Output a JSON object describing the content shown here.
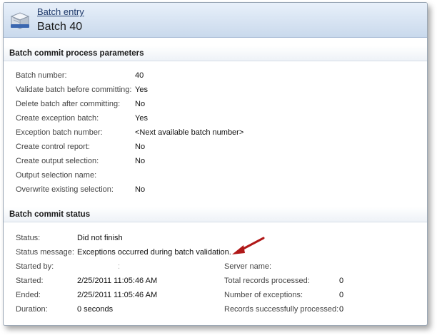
{
  "header": {
    "link": "Batch entry",
    "title": "Batch 40"
  },
  "params": {
    "section_title": "Batch commit process parameters",
    "rows": [
      {
        "label": "Batch number:",
        "value": "40"
      },
      {
        "label": "Validate batch before committing:",
        "value": "Yes"
      },
      {
        "label": "Delete batch after committing:",
        "value": "No"
      },
      {
        "label": "Create exception batch:",
        "value": "Yes"
      },
      {
        "label": "Exception batch number:",
        "value": "<Next available batch number>"
      },
      {
        "label": "Create control report:",
        "value": "No"
      },
      {
        "label": "Create output selection:",
        "value": "No"
      },
      {
        "label": "Output selection name:",
        "value": ""
      },
      {
        "label": "Overwrite existing selection:",
        "value": "No"
      }
    ]
  },
  "status": {
    "section_title": "Batch commit status",
    "status_label": "Status:",
    "status_value": "Did not finish",
    "message_label": "Status message:",
    "message_value": "Exceptions occurred during batch validation.",
    "started_by_label": "Started by:",
    "started_by_value": ":",
    "started_label": "Started:",
    "started_value": "2/25/2011 11:05:46 AM",
    "ended_label": "Ended:",
    "ended_value": "2/25/2011 11:05:46 AM",
    "duration_label": "Duration:",
    "duration_value": "0 seconds",
    "server_label": "Server name:",
    "server_value": "",
    "total_label": "Total records processed:",
    "total_value": "0",
    "exceptions_label": "Number of exceptions:",
    "exceptions_value": "0",
    "success_label": "Records successfully processed:",
    "success_value": "0"
  },
  "colors": {
    "arrow": "#b01818",
    "header_top": "#e8f0fa",
    "header_bottom": "#c9d9ec"
  }
}
